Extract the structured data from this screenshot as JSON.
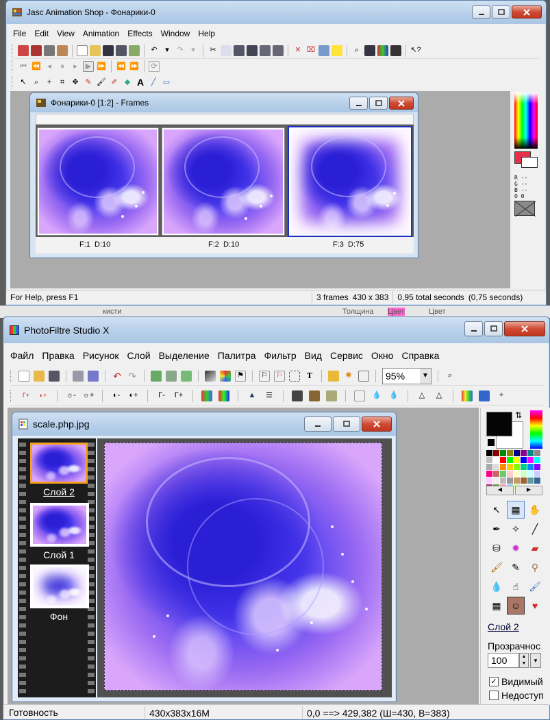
{
  "jasc": {
    "title": "Jasc Animation Shop - Фонарики-0",
    "menu": [
      "File",
      "Edit",
      "View",
      "Animation",
      "Effects",
      "Window",
      "Help"
    ],
    "frames_window": {
      "title": "Фонарики-0 [1:2] - Frames",
      "frames": [
        {
          "label": "F:1  D:10"
        },
        {
          "label": "F:2  D:10"
        },
        {
          "label": "F:3  D:75"
        }
      ]
    },
    "color_panel": {
      "rgbo_labels": [
        "R --",
        "G --",
        "B --",
        "O 0"
      ],
      "primary_color": "#e8304a"
    },
    "status": {
      "help": "For Help, press F1",
      "frames": "3 frames",
      "size": "430 x 383",
      "total": "0,95 total seconds",
      "partial": "(0,75 seconds)"
    }
  },
  "background_strip": {
    "items": [
      "кисти",
      "Толщина",
      "Цвет",
      "Цвет"
    ]
  },
  "photofiltre": {
    "title": "PhotoFiltre Studio X",
    "menu": [
      "Файл",
      "Правка",
      "Рисунок",
      "Слой",
      "Выделение",
      "Палитра",
      "Фильтр",
      "Вид",
      "Сервис",
      "Окно",
      "Справка"
    ],
    "zoom": "95%",
    "image_window": {
      "title": "scale.php.jpg",
      "layers": [
        {
          "name": "Слой 2",
          "selected": true
        },
        {
          "name": "Слой 1",
          "selected": false
        },
        {
          "name": "Фон",
          "selected": false
        }
      ]
    },
    "right_panel": {
      "layer_link": "Слой 2",
      "opacity_label": "Прозрачнос",
      "opacity_value": "100",
      "visible_label": "Видимый",
      "locked_label": "Недоступ"
    },
    "status": {
      "ready": "Готовность",
      "dims": "430x383x16M",
      "coords": "0,0 ==> 429,382 (Ш=430, В=383)"
    }
  }
}
